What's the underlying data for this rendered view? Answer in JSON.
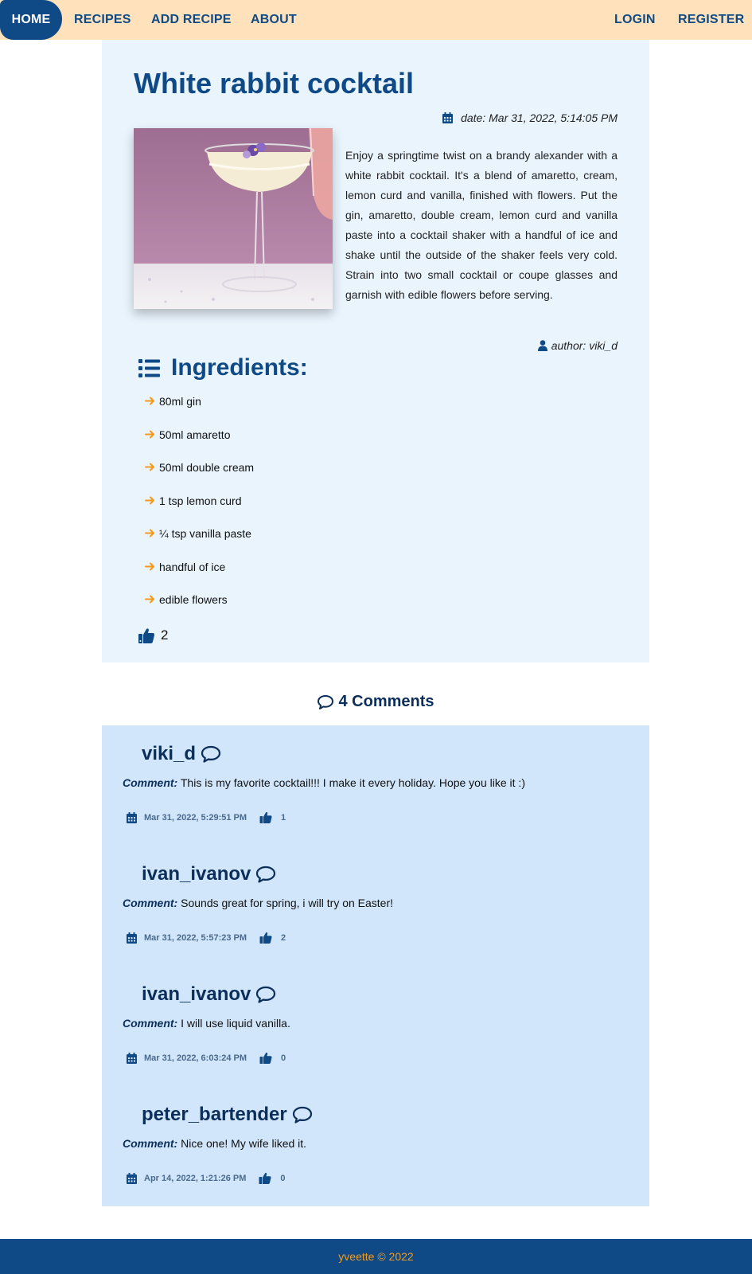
{
  "nav": {
    "home": "HOME",
    "recipes": "RECIPES",
    "add_recipe": "ADD RECIPE",
    "about": "ABOUT",
    "login": "LOGIN",
    "register": "REGISTER"
  },
  "recipe": {
    "title": "White rabbit cocktail",
    "date": "date: Mar 31, 2022, 5:14:05 PM",
    "description": "Enjoy a springtime twist on a brandy alexander with a white rabbit cocktail. It's a blend of amaretto, cream, lemon curd and vanilla, finished with flowers. Put the gin, amaretto, double cream, lemon curd and vanilla paste into a cocktail shaker with a handful of ice and shake until the outside of the shaker feels very cold. Strain into two small cocktail or coupe glasses and garnish with edible flowers before serving.",
    "author": "author: viki_d",
    "ingredients_heading": "Ingredients:",
    "ingredients": [
      "80ml gin",
      "50ml amaretto",
      "50ml double cream",
      "1 tsp lemon curd",
      "¼ tsp vanilla paste",
      "handful of ice",
      "edible flowers"
    ],
    "likes": "2"
  },
  "comments_heading": "4 Comments",
  "comments": [
    {
      "user": "viki_d",
      "label": "Comment:",
      "text": "This is my favorite cocktail!!! I make it every holiday. Hope you like it :)",
      "date": "Mar 31, 2022, 5:29:51 PM",
      "likes": "1"
    },
    {
      "user": "ivan_ivanov",
      "label": "Comment:",
      "text": "Sounds great for spring, i will try on Easter!",
      "date": "Mar 31, 2022, 5:57:23 PM",
      "likes": "2"
    },
    {
      "user": "ivan_ivanov",
      "label": "Comment:",
      "text": "I will use liquid vanilla.",
      "date": "Mar 31, 2022, 6:03:24 PM",
      "likes": "0"
    },
    {
      "user": "peter_bartender",
      "label": "Comment:",
      "text": "Nice one! My wife liked it.",
      "date": "Apr 14, 2022, 1:21:26 PM",
      "likes": "0"
    }
  ],
  "footer": "yveette © 2022",
  "colors": {
    "primary": "#0f4a86",
    "nav_bg": "#ffe1bb",
    "card_bg": "#e9f4fd",
    "comments_bg": "#d1e6fa",
    "accent": "#f39a1c"
  }
}
